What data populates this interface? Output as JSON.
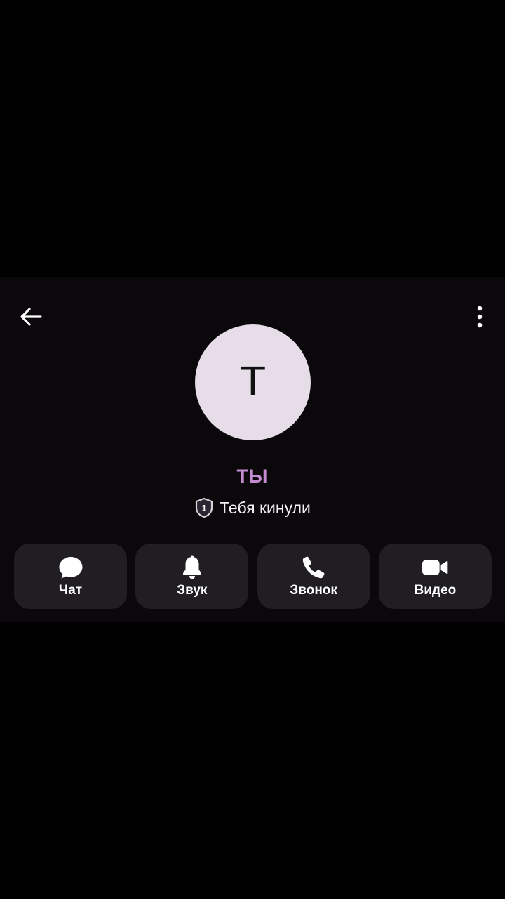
{
  "header": {
    "back_icon": "arrow-left-icon",
    "menu_icon": "more-vertical-icon"
  },
  "profile": {
    "avatar_letter": "T",
    "avatar_color": "#e6dde8",
    "name": "ТЫ",
    "name_color": "#c58bd0",
    "status_badge_number": "1",
    "status_icon": "shield-icon",
    "status_text": "Тебя кинули"
  },
  "actions": [
    {
      "label": "Чат",
      "icon": "chat-bubble-icon"
    },
    {
      "label": "Звук",
      "icon": "bell-icon"
    },
    {
      "label": "Звонок",
      "icon": "phone-icon"
    },
    {
      "label": "Видео",
      "icon": "video-camera-icon"
    }
  ]
}
